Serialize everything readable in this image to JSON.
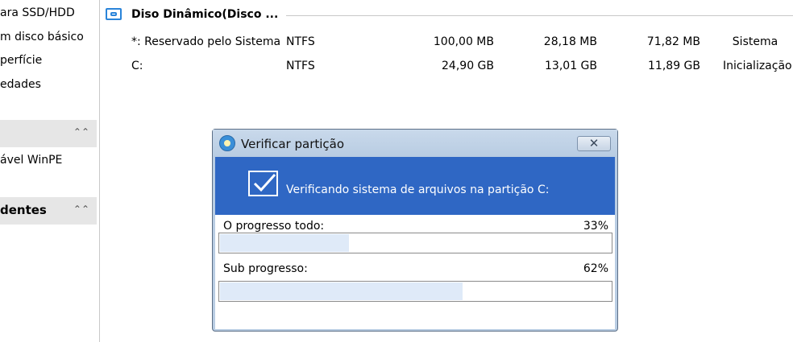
{
  "sidebar": {
    "items": [
      {
        "label": "ara SSD/HDD"
      },
      {
        "label": "m disco básico"
      },
      {
        "label": "perfície"
      },
      {
        "label": "edades"
      }
    ],
    "section2_item": {
      "label": "ável WinPE"
    },
    "section3": {
      "label": "dentes"
    }
  },
  "disk": {
    "title": "Diso Dinâmico(Disco ...",
    "partitions": [
      {
        "name": "*: Reservado pelo Sistema",
        "fs": "NTFS",
        "capacity": "100,00 MB",
        "used": "28,18 MB",
        "free": "71,82 MB",
        "type": "Sistema"
      },
      {
        "name": "C:",
        "fs": "NTFS",
        "capacity": "24,90 GB",
        "used": "13,01 GB",
        "free": "11,89 GB",
        "type": "Inicialização"
      }
    ]
  },
  "dialog": {
    "title": "Verificar partição",
    "message": "Verificando sistema de arquivos na partição C:",
    "overall": {
      "label": "O progresso todo:",
      "percent_text": "33%",
      "value": 0.33
    },
    "sub": {
      "label": "Sub progresso:",
      "percent_text": "62%",
      "value": 0.62
    }
  },
  "icons": {
    "disk": "disk-icon",
    "app": "app-icon",
    "close": "close-icon",
    "check": "checkbox-check-icon",
    "chevron": "chevron-up-icon"
  },
  "colors": {
    "banner": "#2f67c4",
    "progress_fill": "#dfeaf8",
    "accent": "#2a84d9"
  }
}
